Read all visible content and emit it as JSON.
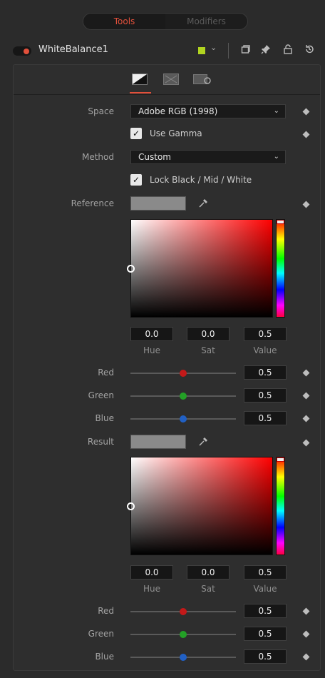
{
  "header": {
    "tabs": [
      {
        "label": "Tools"
      },
      {
        "label": "Modifiers"
      }
    ]
  },
  "tool": {
    "name": "WhiteBalance1",
    "color": "#b1d420"
  },
  "controls": {
    "space": {
      "label": "Space",
      "value": "Adobe RGB (1998)"
    },
    "use_gamma": {
      "label": "Use Gamma",
      "checked": true
    },
    "method": {
      "label": "Method",
      "value": "Custom"
    },
    "lock": {
      "label": "Lock Black / Mid / White",
      "checked": true
    }
  },
  "reference": {
    "label": "Reference",
    "hue": "0.0",
    "sat": "0.0",
    "value": "0.5",
    "hue_label": "Hue",
    "sat_label": "Sat",
    "value_label": "Value",
    "red_label": "Red",
    "green_label": "Green",
    "blue_label": "Blue",
    "red": "0.5",
    "green": "0.5",
    "blue": "0.5"
  },
  "result": {
    "label": "Result",
    "hue": "0.0",
    "sat": "0.0",
    "value": "0.5",
    "hue_label": "Hue",
    "sat_label": "Sat",
    "value_label": "Value",
    "red_label": "Red",
    "green_label": "Green",
    "blue_label": "Blue",
    "red": "0.5",
    "green": "0.5",
    "blue": "0.5"
  },
  "icons": {
    "toggle": "power-toggle-icon",
    "pin": "pin-icon",
    "lock": "lock-icon",
    "reset": "reset-icon",
    "picker": "eyedropper-icon"
  }
}
